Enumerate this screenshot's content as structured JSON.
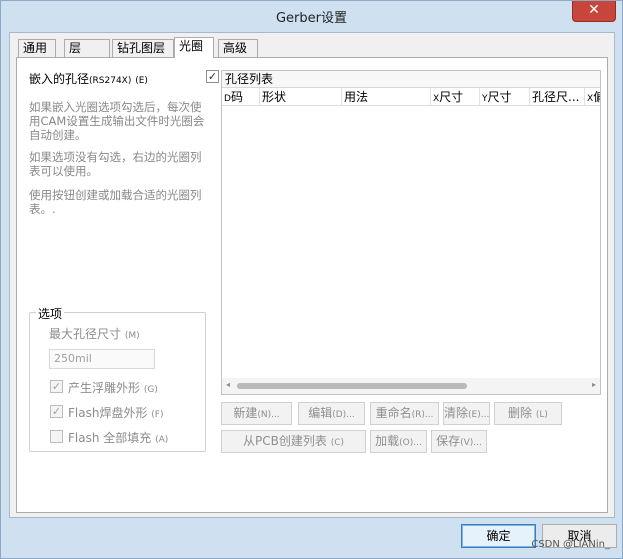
{
  "window": {
    "title": "Gerber设置",
    "close_glyph": "✕"
  },
  "tabs": [
    {
      "label": "通用"
    },
    {
      "label": "层"
    },
    {
      "label": "钻孔图层"
    },
    {
      "label": "光圈"
    },
    {
      "label": "高级"
    }
  ],
  "embed": {
    "label": "嵌入的孔径",
    "label_small": "(RS274X)",
    "shortcut": "(E)",
    "checked": "✓"
  },
  "descriptions": [
    "如果嵌入光圈选项勾选后，每次使用CAM设置生成输出文件时光圈会自动创建。",
    "如果选项没有勾选，右边的光圈列表可以使用。",
    "使用按钮创建或加载合适的光圈列表。."
  ],
  "options": {
    "title": "选项",
    "max_aperture_label": "最大孔径尺寸",
    "max_aperture_shortcut": "(M)",
    "max_aperture_value": "250mil",
    "relief_label": "产生浮雕外形",
    "relief_shortcut": "(G)",
    "relief_check": "✓",
    "flash_pad_label": "Flash焊盘外形",
    "flash_pad_shortcut": "(F)",
    "flash_pad_check": "✓",
    "flash_fill_label": "Flash 全部填充",
    "flash_fill_shortcut": "(A)"
  },
  "list": {
    "title": "孔径列表",
    "columns": [
      {
        "small": "D",
        "label": "码"
      },
      {
        "small": "",
        "label": "形状"
      },
      {
        "small": "",
        "label": "用法"
      },
      {
        "small": "X",
        "label": "尺寸"
      },
      {
        "small": "Y",
        "label": "尺寸"
      },
      {
        "small": "",
        "label": "孔径尺..."
      },
      {
        "small": "X",
        "label": "偏"
      }
    ],
    "scroll_left": "◂",
    "scroll_right": "▸"
  },
  "buttons": {
    "new": {
      "label": "新建",
      "shortcut": "(N)..."
    },
    "edit": {
      "label": "编辑",
      "shortcut": "(D)..."
    },
    "rename": {
      "label": "重命名",
      "shortcut": "(R)..."
    },
    "erase": {
      "label": "清除",
      "shortcut": "(E)..."
    },
    "delete": {
      "label": "删除",
      "shortcut": "(L)"
    },
    "from_pcb": {
      "label": "从PCB创建列表",
      "shortcut": "(C)"
    },
    "load": {
      "label": "加载",
      "shortcut": "(O)..."
    },
    "save": {
      "label": "保存",
      "shortcut": "(V)..."
    }
  },
  "dialog": {
    "ok": "确定",
    "cancel": "取消"
  },
  "watermark": "CSDN @LIANin_"
}
